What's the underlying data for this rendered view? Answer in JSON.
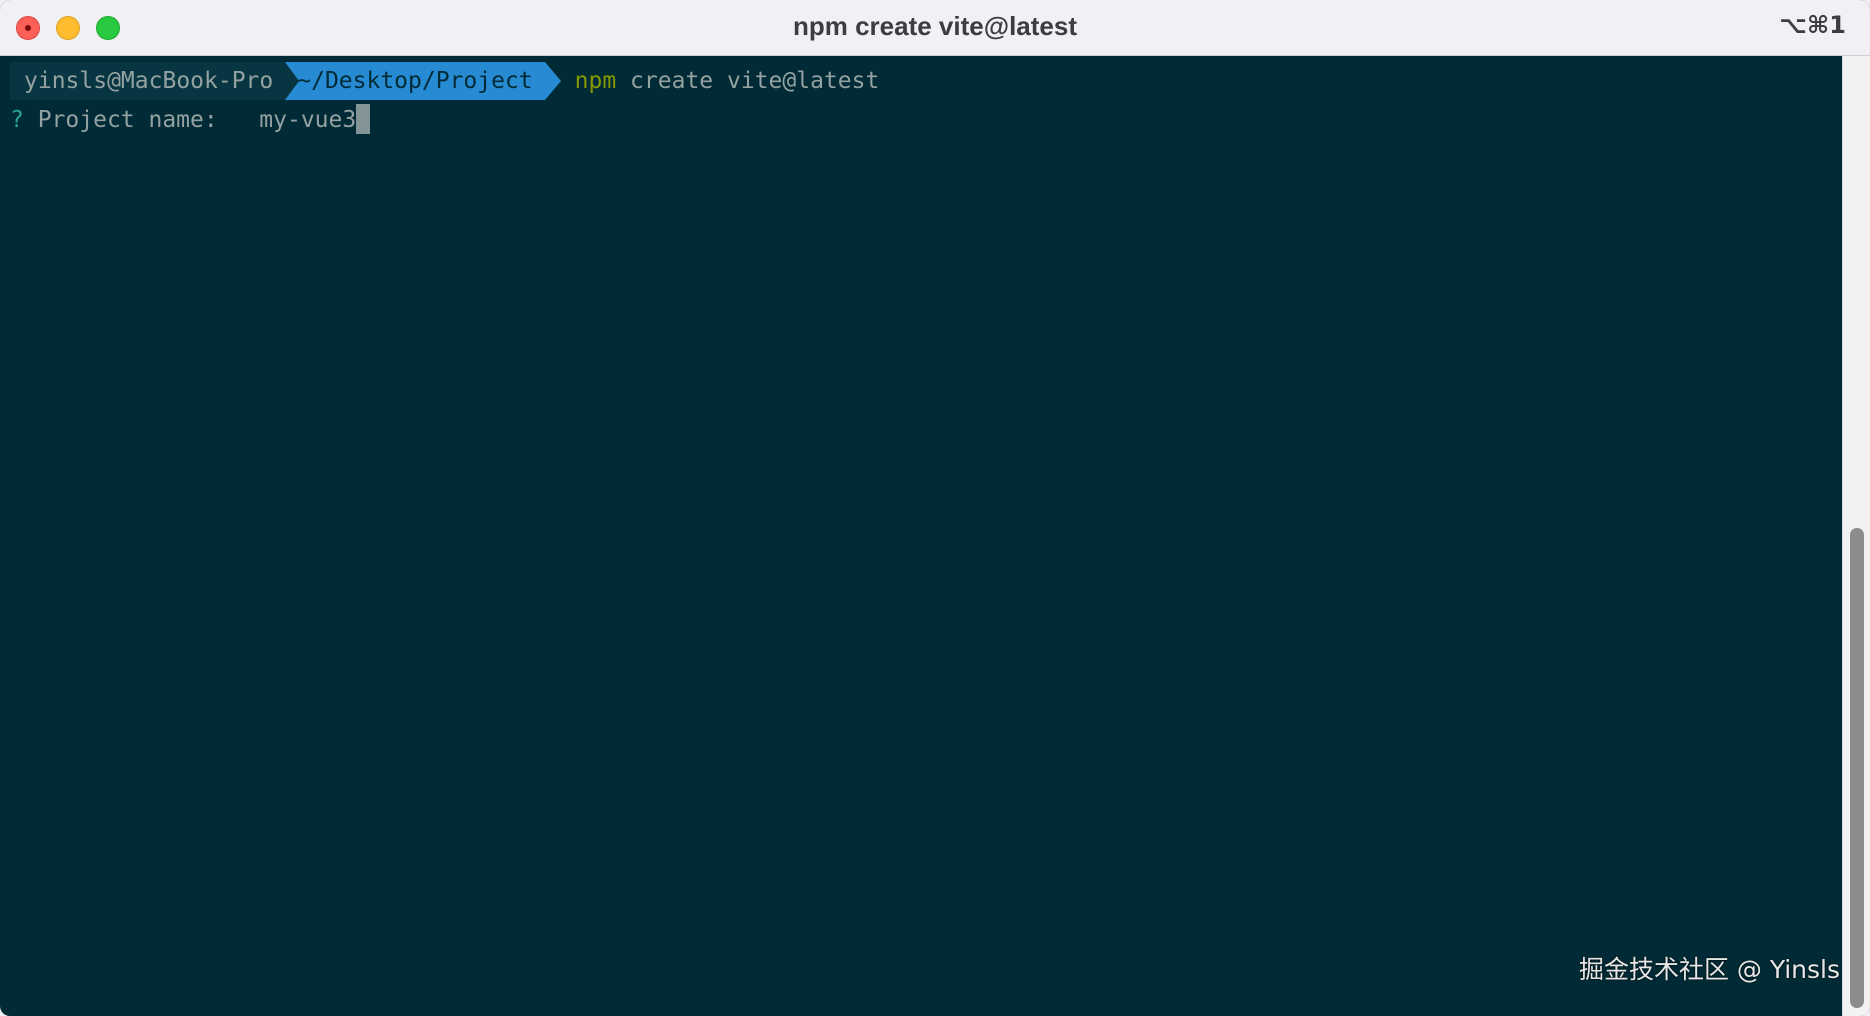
{
  "window": {
    "title": "npm create vite@latest",
    "shortcut": "⌥⌘1"
  },
  "prompt": {
    "user_host": "yinsls@MacBook-Pro",
    "path": "~/Desktop/Project",
    "command_program": "npm",
    "command_args": " create vite@latest"
  },
  "question": {
    "mark": "?",
    "label": " Project name: ",
    "answer": "my-vue3"
  },
  "watermark": "掘金技术社区 @ Yinsls",
  "colors": {
    "terminal_bg": "#002b36",
    "path_segment": "#268bd2",
    "command": "#859900",
    "question_mark": "#2aa198",
    "text": "#93a1a1"
  }
}
